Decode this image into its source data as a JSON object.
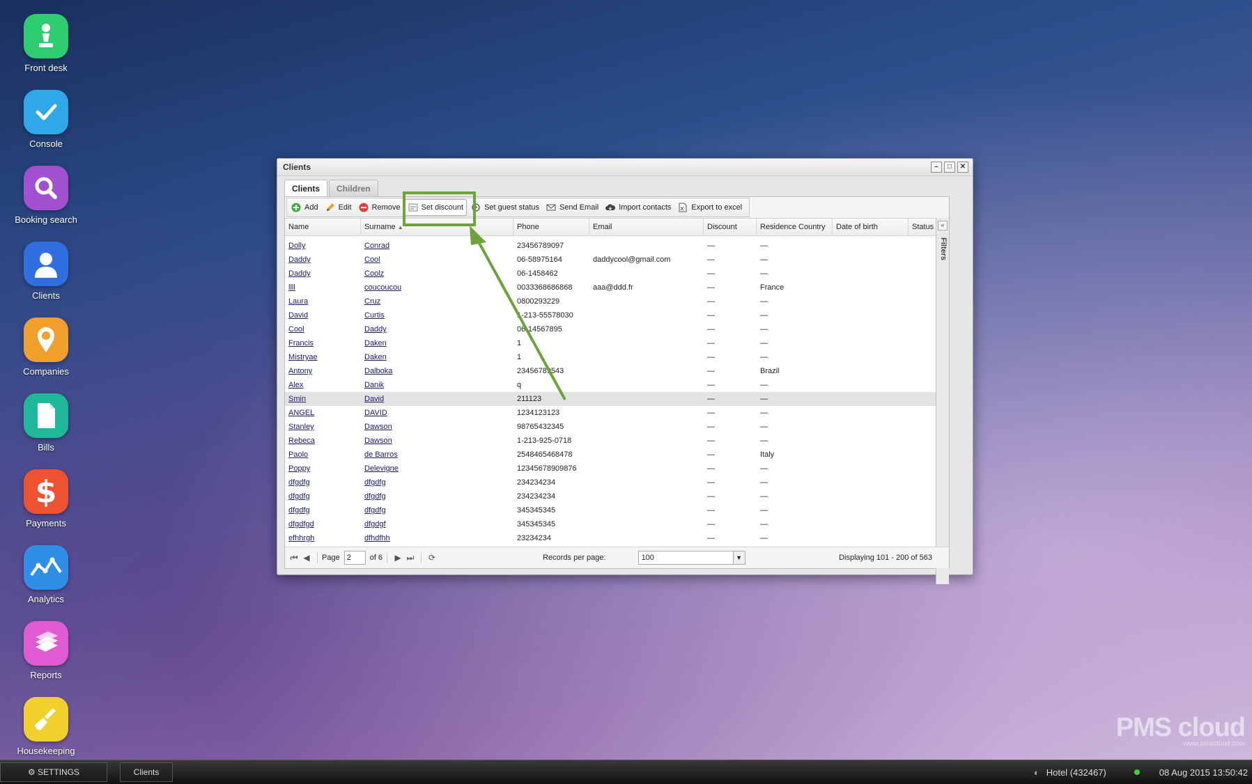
{
  "desktop": {
    "icons": [
      {
        "label": "Front desk",
        "icon": "chess-pawn-icon",
        "color": "#2ecc71"
      },
      {
        "label": "Console",
        "icon": "checkmark-icon",
        "color": "#2ea8e8"
      },
      {
        "label": "Booking search",
        "icon": "magnifier-icon",
        "color": "#a24fd0"
      },
      {
        "label": "Clients",
        "icon": "person-icon",
        "color": "#2f6fe0"
      },
      {
        "label": "Companies",
        "icon": "map-pin-icon",
        "color": "#f2a02c"
      },
      {
        "label": "Bills",
        "icon": "document-icon",
        "color": "#1fb99a"
      },
      {
        "label": "Payments",
        "icon": "dollar-icon",
        "color": "#ef5230"
      },
      {
        "label": "Analytics",
        "icon": "line-chart-icon",
        "color": "#2f8fe8"
      },
      {
        "label": "Reports",
        "icon": "books-icon",
        "color": "#e05bd1"
      },
      {
        "label": "Housekeeping",
        "icon": "broom-icon",
        "color": "#f1d02b"
      }
    ]
  },
  "window": {
    "title": "Clients",
    "tabs": [
      {
        "label": "Clients",
        "active": true
      },
      {
        "label": "Children",
        "active": false
      }
    ],
    "toolbar": {
      "add": "Add",
      "edit": "Edit",
      "remove": "Remove",
      "set_discount": "Set discount",
      "set_guest_status": "Set guest status",
      "send_email": "Send Email",
      "import_contacts": "Import contacts",
      "export_excel": "Export to excel"
    },
    "columns": [
      "Name",
      "Surname",
      "Phone",
      "Email",
      "Discount",
      "Residence Country",
      "Date of birth",
      "Status"
    ],
    "sort_column": "Surname",
    "rows": [
      {
        "name": "Dolly",
        "surname": "Conrad",
        "phone": "23456789097",
        "email": "",
        "discount": "—",
        "country": "—",
        "dob": "",
        "status": ""
      },
      {
        "name": "Daddy",
        "surname": "Cool",
        "phone": "06-58975164",
        "email": "daddycool@gmail.com",
        "discount": "—",
        "country": "—",
        "dob": "",
        "status": ""
      },
      {
        "name": "Daddy",
        "surname": "Coolz",
        "phone": "06-1458462",
        "email": "",
        "discount": "—",
        "country": "—",
        "dob": "",
        "status": ""
      },
      {
        "name": "llll",
        "surname": "coucoucou",
        "phone": "0033368686868",
        "email": "aaa@ddd.fr",
        "discount": "—",
        "country": "France",
        "dob": "",
        "status": ""
      },
      {
        "name": "Laura",
        "surname": "Cruz",
        "phone": "0800293229",
        "email": "",
        "discount": "—",
        "country": "—",
        "dob": "",
        "status": ""
      },
      {
        "name": "David",
        "surname": "Curtis",
        "phone": "1-213-55578030",
        "email": "",
        "discount": "—",
        "country": "—",
        "dob": "",
        "status": ""
      },
      {
        "name": "Cool",
        "surname": "Daddy",
        "phone": "06-14567895",
        "email": "",
        "discount": "—",
        "country": "—",
        "dob": "",
        "status": ""
      },
      {
        "name": "Francis",
        "surname": "Daken",
        "phone": "1",
        "email": "",
        "discount": "—",
        "country": "—",
        "dob": "",
        "status": ""
      },
      {
        "name": "Mistryae",
        "surname": "Daken",
        "phone": "1",
        "email": "",
        "discount": "—",
        "country": "—",
        "dob": "",
        "status": ""
      },
      {
        "name": "Antony",
        "surname": "Dalboka",
        "phone": "23456789543",
        "email": "",
        "discount": "—",
        "country": "Brazil",
        "dob": "",
        "status": ""
      },
      {
        "name": "Alex",
        "surname": "Danik",
        "phone": "q",
        "email": "",
        "discount": "—",
        "country": "—",
        "dob": "",
        "status": ""
      },
      {
        "name": "Smin",
        "surname": "David",
        "phone": "211123",
        "email": "",
        "discount": "—",
        "country": "—",
        "dob": "",
        "status": "",
        "selected": true
      },
      {
        "name": "ANGEL",
        "surname": "DAVID",
        "phone": "1234123123",
        "email": "",
        "discount": "—",
        "country": "—",
        "dob": "",
        "status": ""
      },
      {
        "name": "Stanley",
        "surname": "Dawson",
        "phone": "98765432345",
        "email": "",
        "discount": "—",
        "country": "—",
        "dob": "",
        "status": ""
      },
      {
        "name": "Rebeca",
        "surname": "Dawson",
        "phone": "1-213-925-0718",
        "email": "",
        "discount": "—",
        "country": "—",
        "dob": "",
        "status": ""
      },
      {
        "name": "Paolo",
        "surname": "de Barros",
        "phone": "2548465468478",
        "email": "",
        "discount": "—",
        "country": "Italy",
        "dob": "",
        "status": ""
      },
      {
        "name": "Poppy",
        "surname": "Delevigne",
        "phone": "12345678909876",
        "email": "",
        "discount": "—",
        "country": "—",
        "dob": "",
        "status": ""
      },
      {
        "name": "dfgdfg",
        "surname": "dfgdfg",
        "phone": "234234234",
        "email": "",
        "discount": "—",
        "country": "—",
        "dob": "",
        "status": ""
      },
      {
        "name": "dfgdfg",
        "surname": "dfgdfg",
        "phone": "234234234",
        "email": "",
        "discount": "—",
        "country": "—",
        "dob": "",
        "status": ""
      },
      {
        "name": "dfgdfg",
        "surname": "dfgdfg",
        "phone": "345345345",
        "email": "",
        "discount": "—",
        "country": "—",
        "dob": "",
        "status": ""
      },
      {
        "name": "dfgdfgd",
        "surname": "dfgdgf",
        "phone": "345345345",
        "email": "",
        "discount": "—",
        "country": "—",
        "dob": "",
        "status": ""
      },
      {
        "name": "efhhrgh",
        "surname": "dfhdfhh",
        "phone": "23234234",
        "email": "",
        "discount": "—",
        "country": "—",
        "dob": "",
        "status": ""
      }
    ],
    "pager": {
      "page_label": "Page",
      "page_value": "2",
      "of_label": "of 6",
      "records_label": "Records per page:",
      "records_value": "100",
      "display_text": "Displaying 101 - 200 of 563"
    },
    "filters_label": "Filters"
  },
  "taskbar": {
    "settings": "SETTINGS",
    "open_window": "Clients",
    "hotel": "Hotel (432467)",
    "datetime": "08 Aug 2015 13:50:42"
  },
  "brand": {
    "logo": "PMS cloud",
    "url": "www.pmscloud.com"
  },
  "annotation": {
    "color": "#6ea33c",
    "target": "Set discount"
  }
}
